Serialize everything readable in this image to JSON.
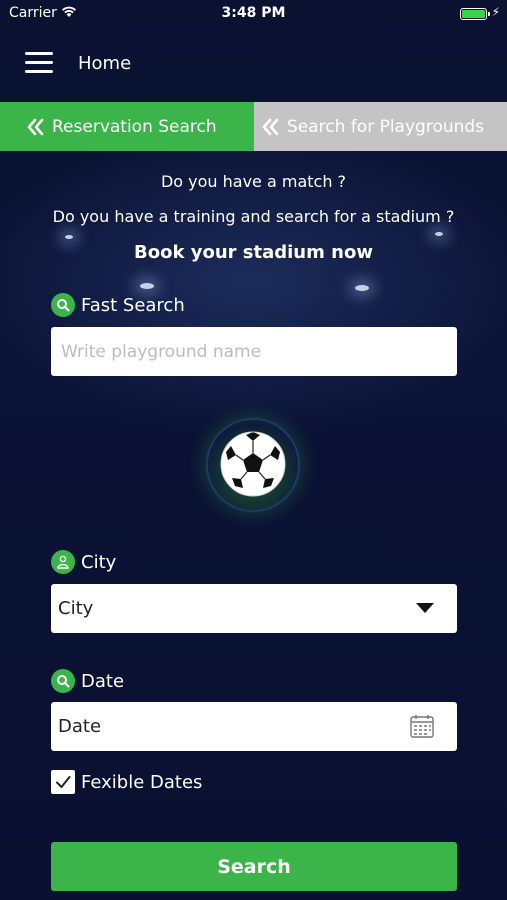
{
  "status_bar": {
    "carrier": "Carrier",
    "time": "3:48 PM",
    "battery_level": 1.0
  },
  "nav": {
    "title": "Home",
    "menu_icon": "hamburger-icon"
  },
  "tabs": [
    {
      "label": "Reservation Search",
      "active": true,
      "icon": "double-chevron-left-icon"
    },
    {
      "label": "Search for Playgrounds",
      "active": false,
      "icon": "double-chevron-left-icon"
    }
  ],
  "intro": {
    "question1": "Do you have a match ?",
    "question2": "Do you have a training and search for a stadium ?",
    "headline": "Book your stadium now"
  },
  "fast_search": {
    "label": "Fast Search",
    "placeholder": "Write playground name",
    "value": ""
  },
  "city": {
    "label": "City",
    "selected": "City"
  },
  "date": {
    "label": "Date",
    "value": "Date"
  },
  "flexible_dates": {
    "label": "Fexible Dates",
    "checked": true
  },
  "search_button": {
    "label": "Search"
  },
  "colors": {
    "accent": "#3bb54a",
    "background": "#0b1233",
    "inactive_tab": "#c4c4c4"
  }
}
